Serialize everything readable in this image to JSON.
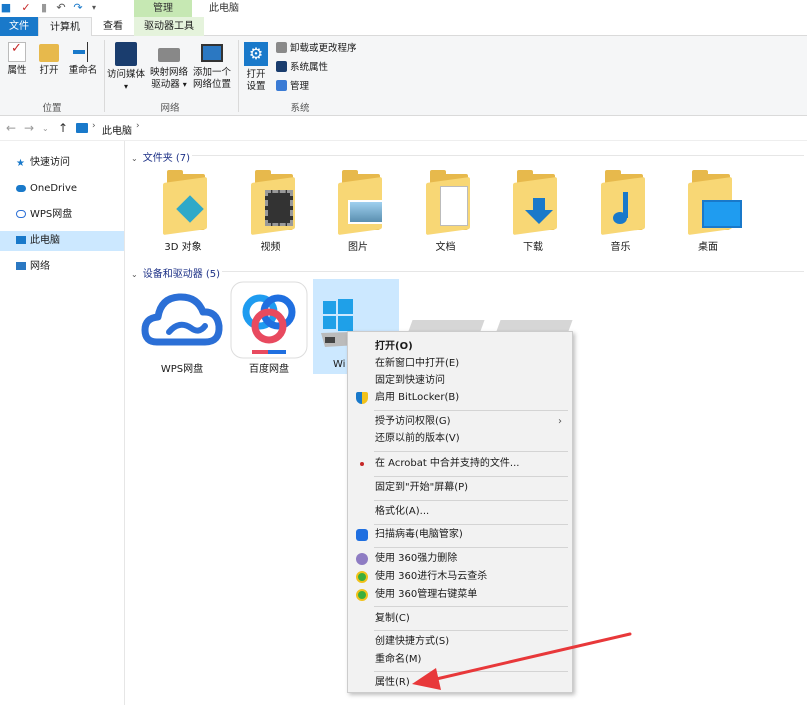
{
  "title_bar": {
    "manage_tab": "管理",
    "title": "此电脑"
  },
  "tabs": {
    "file": "文件",
    "computer": "计算机",
    "view": "查看",
    "drive_tools": "驱动器工具"
  },
  "ribbon": {
    "location": {
      "properties": "属性",
      "open": "打开",
      "rename": "重命名",
      "group": "位置"
    },
    "network": {
      "access_media": "访问媒体",
      "map_drive_1": "映射网络",
      "map_drive_2": "驱动器",
      "add_location_1": "添加一个",
      "add_location_2": "网络位置",
      "group": "网络"
    },
    "system": {
      "open_settings_1": "打开",
      "open_settings_2": "设置",
      "uninstall": "卸载或更改程序",
      "sys_props": "系统属性",
      "manage": "管理",
      "group": "系统"
    }
  },
  "address": {
    "path": "此电脑"
  },
  "nav_pane": {
    "quick_access": "快速访问",
    "onedrive": "OneDrive",
    "wps": "WPS网盘",
    "this_pc": "此电脑",
    "network": "网络"
  },
  "folders_section": {
    "header": "文件夹 (7)"
  },
  "folders": [
    "3D 对象",
    "视频",
    "图片",
    "文档",
    "下载",
    "音乐",
    "桌面"
  ],
  "devices_section": {
    "header": "设备和驱动器 (5)"
  },
  "devices": [
    "WPS网盘",
    "百度网盘",
    "Wi"
  ],
  "context_menu": {
    "open": "打开(O)",
    "open_new_window": "在新窗口中打开(E)",
    "pin_quick": "固定到快速访问",
    "bitlocker": "启用 BitLocker(B)",
    "grant_access": "授予访问权限(G)",
    "restore": "还原以前的版本(V)",
    "acrobat": "在 Acrobat 中合并支持的文件...",
    "pin_start": "固定到\"开始\"屏幕(P)",
    "format": "格式化(A)...",
    "scan": "扫描病毒(电脑管家)",
    "force_delete": "使用 360强力删除",
    "trojan_scan": "使用 360进行木马云查杀",
    "manage_menu": "使用 360管理右键菜单",
    "copy": "复制(C)",
    "shortcut": "创建快捷方式(S)",
    "rename": "重命名(M)",
    "properties": "属性(R)"
  },
  "colors": {
    "accent": "#1979ca",
    "selection": "#cce8ff",
    "folder": "#f8d775",
    "annotation": "#e8383a"
  }
}
